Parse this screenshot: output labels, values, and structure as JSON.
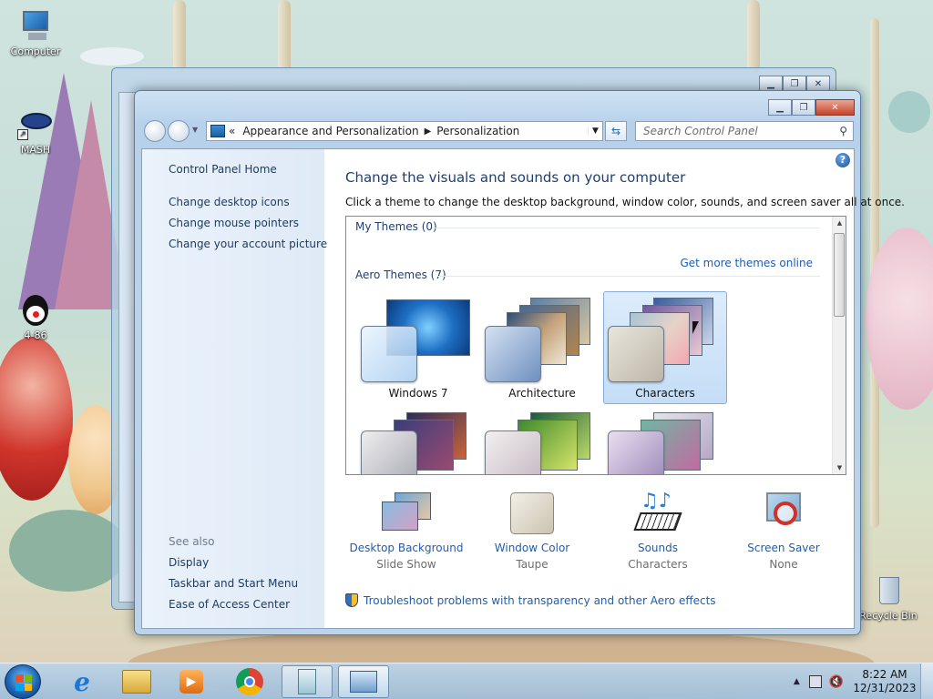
{
  "desktop": {
    "icons": [
      {
        "label": "Computer",
        "icon": "computer-icon"
      },
      {
        "label": "MASH",
        "icon": "mash-icon"
      },
      {
        "label": "4-86",
        "icon": "cartoon-icon"
      },
      {
        "label": "Recycle Bin",
        "icon": "recycle-bin-icon"
      }
    ]
  },
  "window": {
    "title": "Personalization",
    "address": {
      "overflow": "«",
      "crumbs": [
        "Appearance and Personalization",
        "Personalization"
      ]
    },
    "search_placeholder": "Search Control Panel",
    "left_nav": {
      "home": "Control Panel Home",
      "links": [
        "Change desktop icons",
        "Change mouse pointers",
        "Change your account picture"
      ],
      "see_also_label": "See also",
      "see_also": [
        "Display",
        "Taskbar and Start Menu",
        "Ease of Access Center"
      ]
    },
    "heading": "Change the visuals and sounds on your computer",
    "subheading": "Click a theme to change the desktop background, window color, sounds, and screen saver all at once.",
    "themes": {
      "my_themes_label": "My Themes (0)",
      "get_more": "Get more themes online",
      "aero_label": "Aero Themes (7)",
      "items": [
        {
          "name": "Windows 7",
          "selected": false
        },
        {
          "name": "Architecture",
          "selected": false
        },
        {
          "name": "Characters",
          "selected": true
        },
        {
          "name": "",
          "selected": false
        },
        {
          "name": "",
          "selected": false
        },
        {
          "name": "",
          "selected": false
        }
      ]
    },
    "settings": [
      {
        "title": "Desktop Background",
        "value": "Slide Show",
        "icon": "desktop-background-icon"
      },
      {
        "title": "Window Color",
        "value": "Taupe",
        "icon": "window-color-icon"
      },
      {
        "title": "Sounds",
        "value": "Characters",
        "icon": "sounds-icon"
      },
      {
        "title": "Screen Saver",
        "value": "None",
        "icon": "screen-saver-icon"
      }
    ],
    "troubleshoot": "Troubleshoot problems with transparency and other Aero effects"
  },
  "taskbar": {
    "pinned": [
      "internet-explorer-icon",
      "windows-explorer-icon",
      "media-player-icon",
      "chrome-icon",
      "notepad-icon",
      "control-panel-icon"
    ],
    "clock_time": "8:22 AM",
    "clock_date": "12/31/2023"
  },
  "colors": {
    "link": "#1e5db0",
    "heading": "#1e3f74",
    "selection": "#c4ddf6"
  }
}
